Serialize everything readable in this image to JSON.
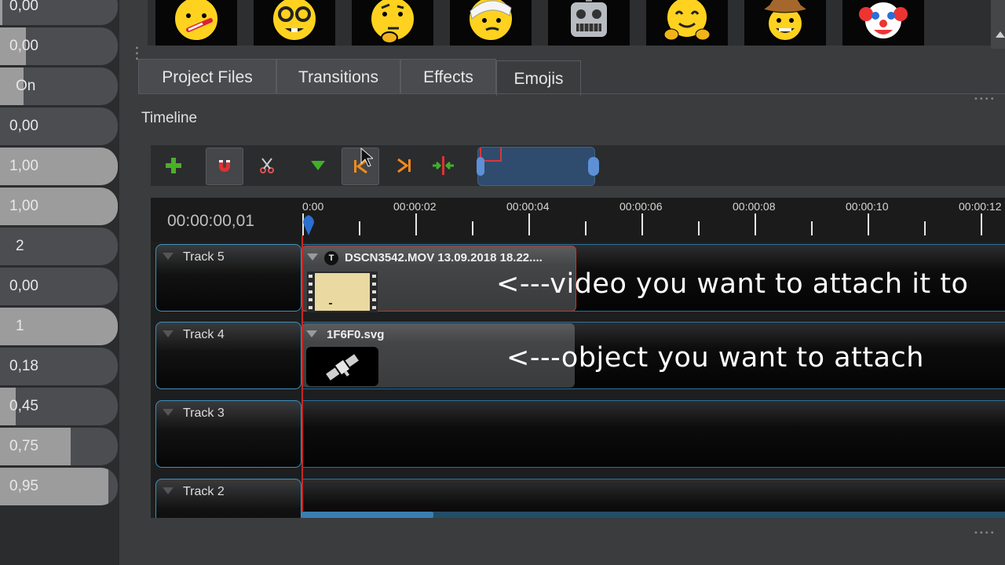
{
  "properties_panel": {
    "rows": [
      {
        "value": "0,00",
        "fill": 0.02
      },
      {
        "value": "0,00",
        "fill": 0.22
      },
      {
        "value": "On",
        "fill": 0.2
      },
      {
        "value": "0,00",
        "fill": 0.0
      },
      {
        "value": "1,00",
        "fill": 1.0
      },
      {
        "value": "1,00",
        "fill": 1.0
      },
      {
        "value": "2",
        "fill": 0.0
      },
      {
        "value": "0,00",
        "fill": 0.0
      },
      {
        "value": "1",
        "fill": 1.0
      },
      {
        "value": "0,18",
        "fill": 0.0
      },
      {
        "value": "0,45",
        "fill": 0.13
      },
      {
        "value": "0,75",
        "fill": 0.6
      },
      {
        "value": "0,95",
        "fill": 0.92
      }
    ]
  },
  "emoji_strip": {
    "items": [
      "thermometer-face",
      "nerd-face",
      "thinking-face",
      "bandaged-head-face",
      "robot-face",
      "hugging-face",
      "cowboy-face",
      "clown-face"
    ]
  },
  "tabs": [
    {
      "label": "Project Files",
      "active": false
    },
    {
      "label": "Transitions",
      "active": false
    },
    {
      "label": "Effects",
      "active": false
    },
    {
      "label": "Emojis",
      "active": true
    }
  ],
  "timeline": {
    "title": "Timeline",
    "current_time": "00:00:00,01",
    "ruler_labels": [
      "0:00",
      "00:00:02",
      "00:00:04",
      "00:00:06",
      "00:00:08",
      "00:00:10",
      "00:00:12"
    ],
    "toolbar": [
      "add-track-icon",
      "snap-magnet-icon",
      "razor-icon",
      "add-marker-icon",
      "jump-to-start-icon",
      "jump-to-end-icon",
      "center-playhead-icon"
    ],
    "tracks": [
      {
        "name": "Track 5",
        "clip": {
          "title": "DSCN3542.MOV 13.09.2018 18.22....",
          "badge": "T"
        }
      },
      {
        "name": "Track 4",
        "clip": {
          "title": "1F6F0.svg"
        }
      },
      {
        "name": "Track 3"
      },
      {
        "name": "Track 2"
      }
    ]
  },
  "annotations": {
    "video_note": "<---video you want to attach it to",
    "object_note": "<---object you want to attach"
  },
  "colors": {
    "accent_blue": "#3f8fb8",
    "playhead_red": "#c62828",
    "emoji_yellow": "#ffd21f"
  }
}
